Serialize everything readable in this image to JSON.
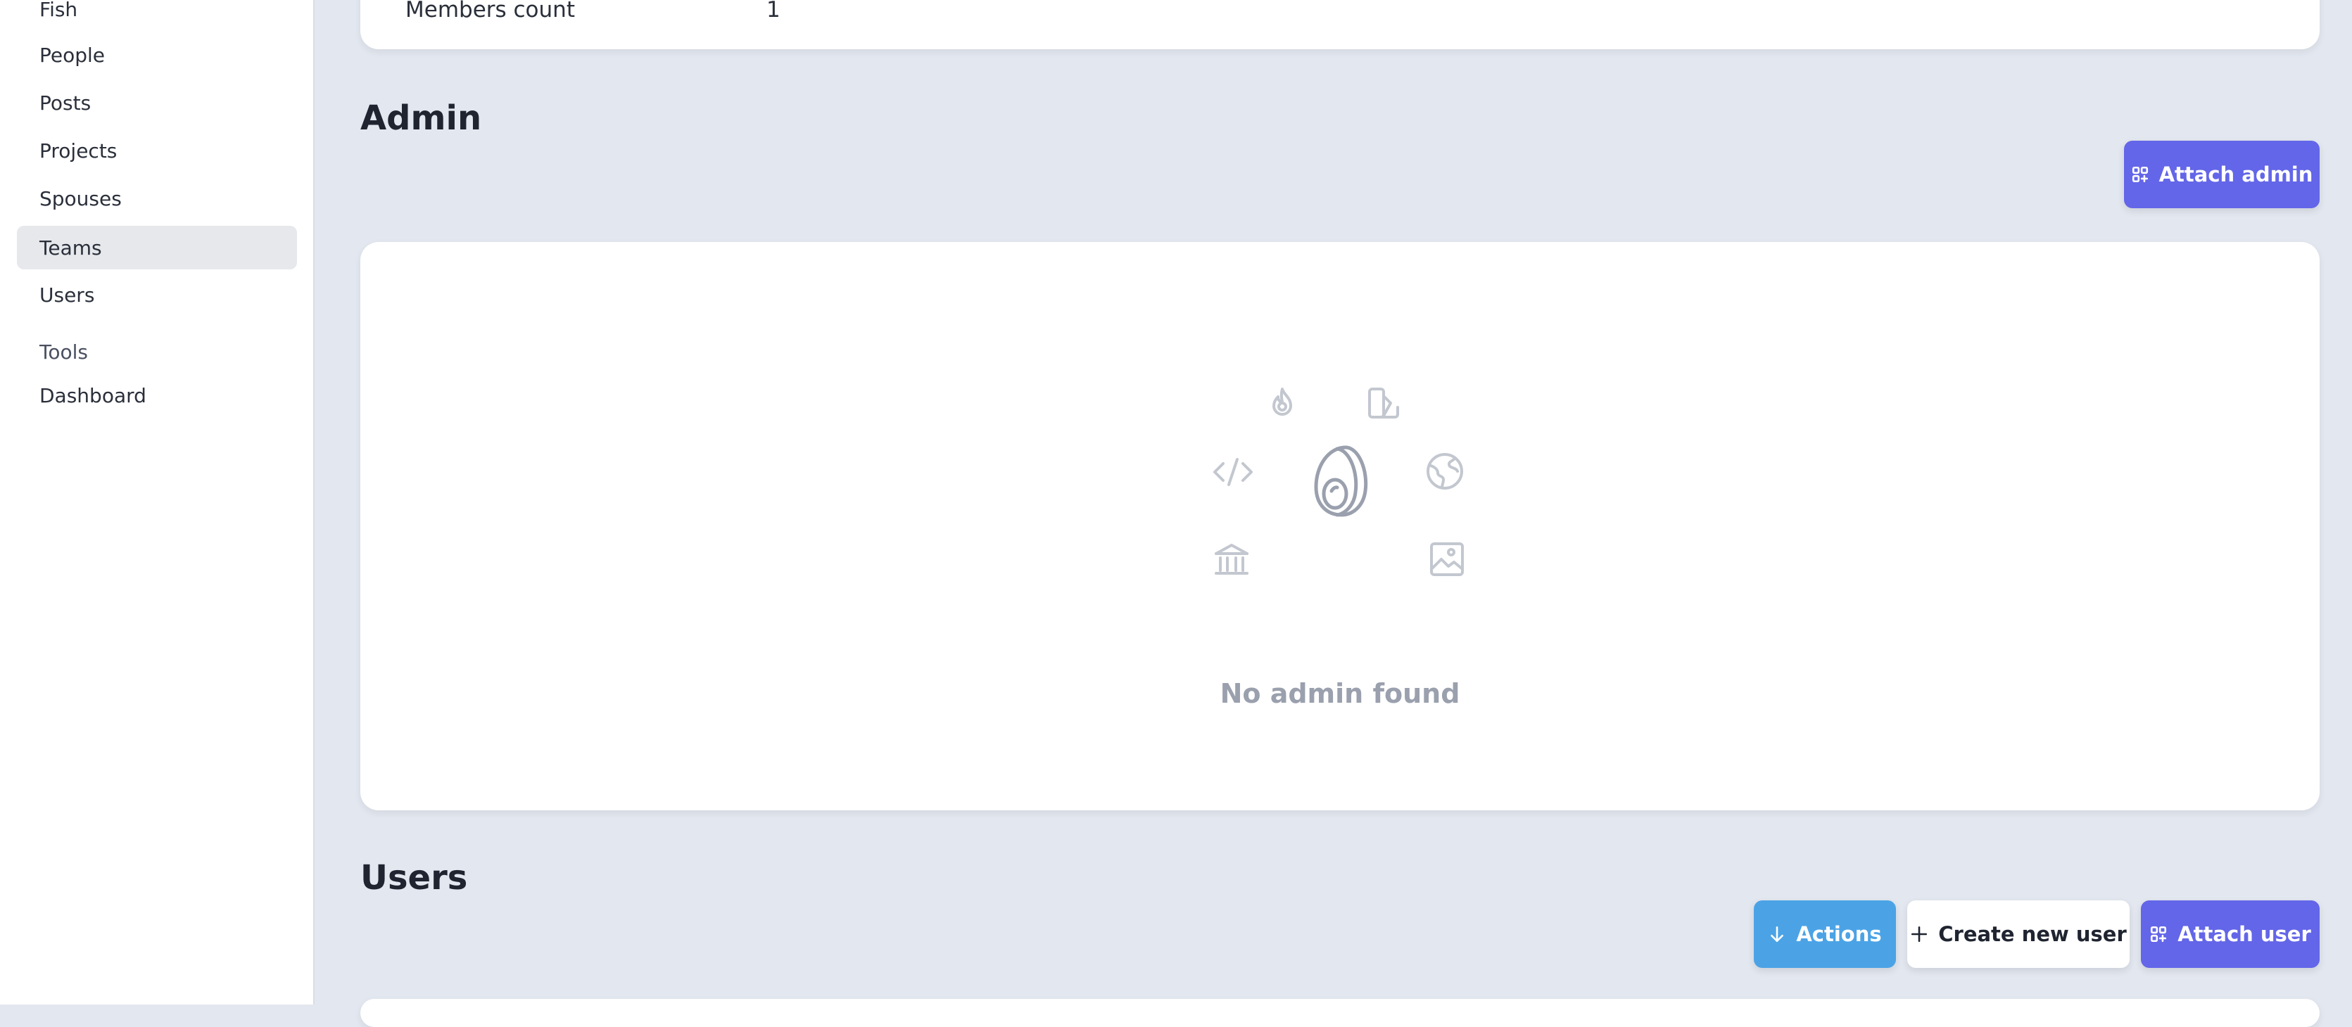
{
  "sidebar": {
    "items": [
      {
        "label": "Fish"
      },
      {
        "label": "People"
      },
      {
        "label": "Posts"
      },
      {
        "label": "Projects"
      },
      {
        "label": "Spouses"
      },
      {
        "label": "Teams",
        "active": true
      },
      {
        "label": "Users"
      }
    ],
    "tools_heading": "Tools",
    "tools_items": [
      {
        "label": "Dashboard"
      }
    ]
  },
  "details": {
    "members_count_label": "Members count",
    "members_count_value": "1"
  },
  "admin": {
    "title": "Admin",
    "attach_label": "Attach admin",
    "empty_text": "No admin found"
  },
  "users": {
    "title": "Users",
    "actions_label": "Actions",
    "create_label": "Create new user",
    "attach_label": "Attach user"
  },
  "colors": {
    "primary": "#6366e8",
    "actions": "#4ba3e6",
    "background": "#e3e7ef"
  },
  "icons": {
    "attach": "attach-grid-icon",
    "actions": "arrow-down-icon",
    "create": "plus-icon",
    "empty": [
      "flame-icon",
      "swatch-icon",
      "code-icon",
      "globe-icon",
      "avocado-icon",
      "bank-icon",
      "image-icon"
    ]
  }
}
